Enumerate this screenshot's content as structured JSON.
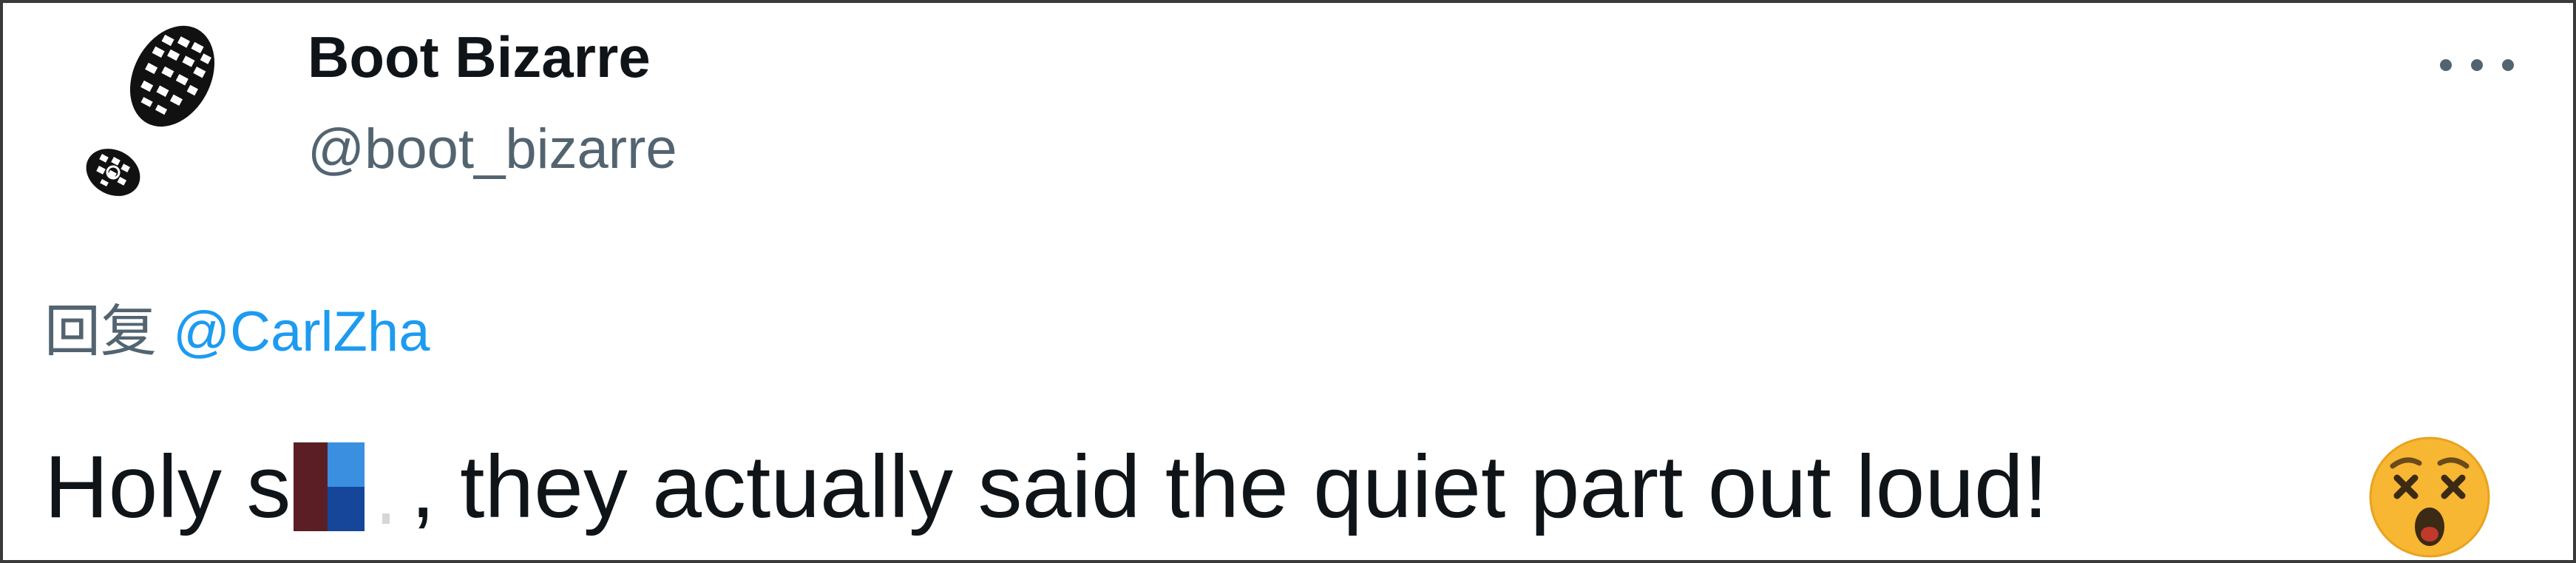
{
  "user": {
    "display_name": "Boot Bizarre",
    "handle": "@boot_bizarre",
    "avatar_icon": "boot-print-avatar"
  },
  "menu": {
    "more_icon": "more-horizontal-icon"
  },
  "reply": {
    "prefix": "回复",
    "mention": "@CarlZha"
  },
  "tweet": {
    "text_start": "Holy s",
    "text_end": ", they actually said the quiet part out loud!",
    "emoji_icon": "dizzy-face-emoji"
  },
  "colors": {
    "text_primary": "#0f1419",
    "text_secondary": "#536471",
    "link": "#1d9bf0",
    "frame_border": "#3a3a3a",
    "emoji": "#f7b733"
  }
}
